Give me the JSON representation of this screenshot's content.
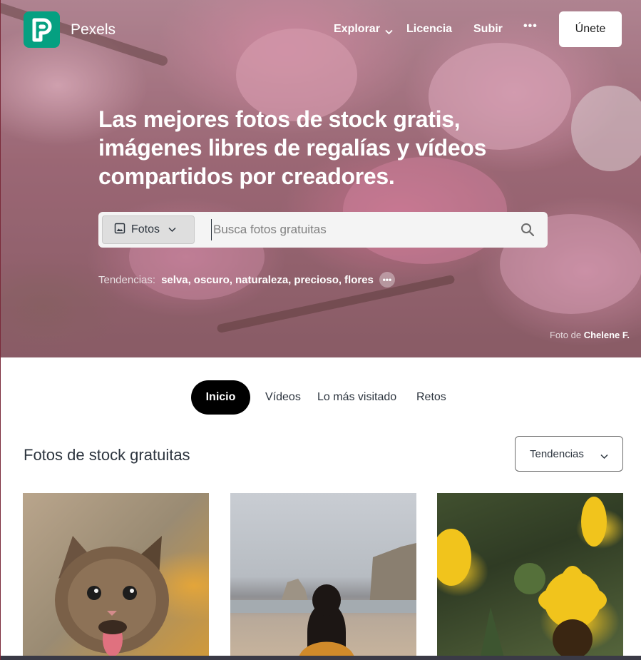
{
  "brand": {
    "name": "Pexels",
    "color": "#05a081"
  },
  "nav": {
    "explore_label": "Explorar",
    "license_label": "Licencia",
    "upload_label": "Subir",
    "more_label": "•••",
    "join_label": "Únete"
  },
  "hero": {
    "headline": "Las mejores fotos de stock gratis, imágenes libres de regalías y vídeos compartidos por creadores.",
    "search": {
      "type_label": "Fotos",
      "placeholder": "Busca fotos gratuitas",
      "value": ""
    },
    "trending": {
      "label": "Tendencias:",
      "items": [
        "selva",
        "oscuro",
        "naturaleza",
        "precioso",
        "flores"
      ],
      "separator": ","
    },
    "credit": {
      "prefix": "Foto de",
      "author": "Chelene F."
    }
  },
  "tabs": {
    "items": [
      "Inicio",
      "Vídeos",
      "Lo más visitado",
      "Retos"
    ],
    "active": "Inicio"
  },
  "section": {
    "title": "Fotos de stock gratuitas",
    "sort_value": "Tendencias"
  },
  "photos": [
    {
      "subject": "kitten"
    },
    {
      "subject": "woman-on-beach"
    },
    {
      "subject": "sunflowers"
    }
  ],
  "icons": {
    "logo": "pexels-logo-icon",
    "image": "image-icon",
    "chevron": "chevron-down-icon",
    "search": "search-icon",
    "more": "more-dots-icon"
  }
}
